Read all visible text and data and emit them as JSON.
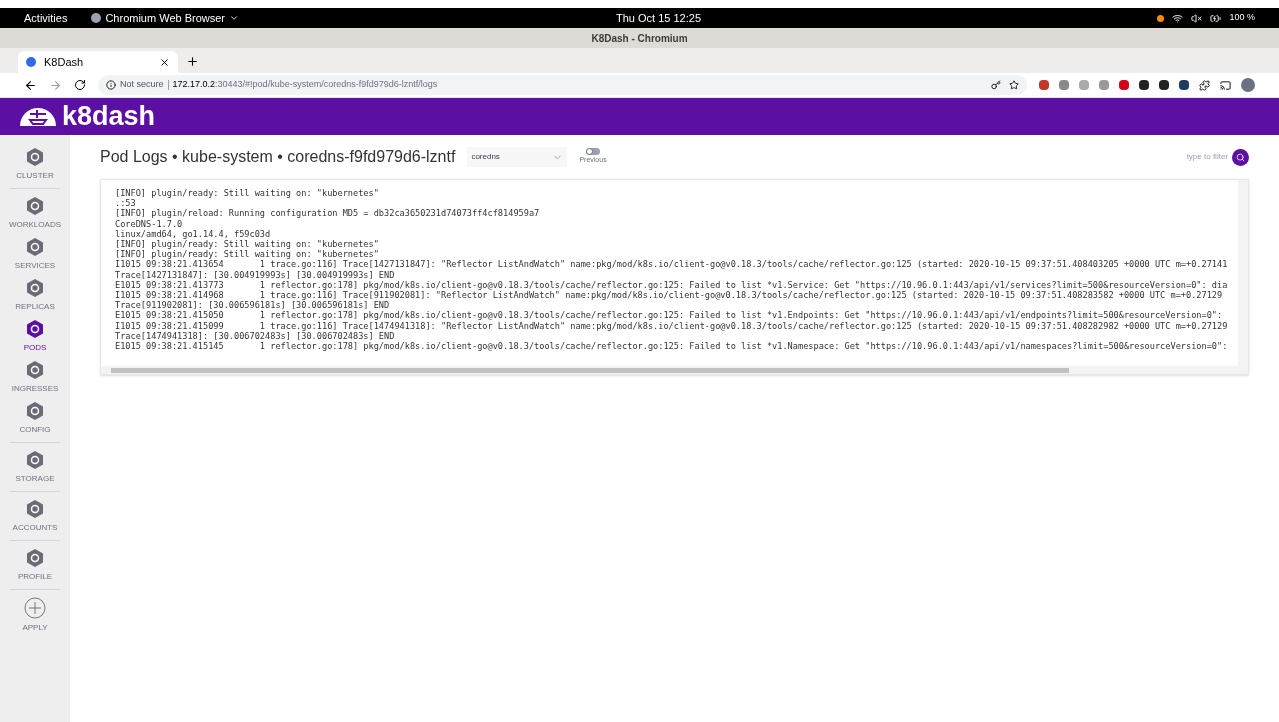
{
  "system_bar": {
    "activities": "Activities",
    "app_menu": "Chromium Web Browser",
    "clock": "Thu Oct 15  12:25",
    "battery": "100 %"
  },
  "window": {
    "title": "K8Dash - Chromium"
  },
  "tabs": [
    {
      "label": "K8Dash",
      "selected": true
    }
  ],
  "address_bar": {
    "security": "Not secure",
    "host": "172.17.0.2",
    "path": ":30443/#!pod/kube-system/coredns-f9fd979d6-lzntf/logs"
  },
  "app": {
    "logo": "k8dash"
  },
  "sidebar": {
    "items": [
      {
        "label": "CLUSTER",
        "selected": false,
        "divider_after": true
      },
      {
        "label": "WORKLOADS",
        "selected": false,
        "divider_after": false
      },
      {
        "label": "SERVICES",
        "selected": false,
        "divider_after": false
      },
      {
        "label": "REPLICAS",
        "selected": false,
        "divider_after": false
      },
      {
        "label": "PODS",
        "selected": true,
        "divider_after": false
      },
      {
        "label": "INGRESSES",
        "selected": false,
        "divider_after": false
      },
      {
        "label": "CONFIG",
        "selected": false,
        "divider_after": true
      },
      {
        "label": "STORAGE",
        "selected": false,
        "divider_after": true
      },
      {
        "label": "ACCOUNTS",
        "selected": false,
        "divider_after": true
      },
      {
        "label": "PROFILE",
        "selected": false,
        "divider_after": true
      },
      {
        "label": "APPLY",
        "selected": false,
        "divider_after": false
      }
    ]
  },
  "page": {
    "title": "Pod Logs • kube-system • coredns-f9fd979d6-lzntf",
    "container_select": "coredns",
    "previous_toggle": {
      "label": "Previous",
      "on": false
    },
    "filter": {
      "placeholder": "type to filter"
    }
  },
  "logs": [
    "[INFO] plugin/ready: Still waiting on: \"kubernetes\"",
    ".:53",
    "[INFO] plugin/reload: Running configuration MD5 = db32ca3650231d74073ff4cf814959a7",
    "CoreDNS-1.7.0",
    "linux/amd64, go1.14.4, f59c03d",
    "[INFO] plugin/ready: Still waiting on: \"kubernetes\"",
    "[INFO] plugin/ready: Still waiting on: \"kubernetes\"",
    "I1015 09:38:21.413654       1 trace.go:116] Trace[1427131847]: \"Reflector ListAndWatch\" name:pkg/mod/k8s.io/client-go@v0.18.3/tools/cache/reflector.go:125 (started: 2020-10-15 09:37:51.408403205 +0000 UTC m=+0.27141",
    "Trace[1427131847]: [30.004919993s] [30.004919993s] END",
    "E1015 09:38:21.413773       1 reflector.go:178] pkg/mod/k8s.io/client-go@v0.18.3/tools/cache/reflector.go:125: Failed to list *v1.Service: Get \"https://10.96.0.1:443/api/v1/services?limit=500&resourceVersion=0\": dia",
    "I1015 09:38:21.414968       1 trace.go:116] Trace[911902081]: \"Reflector ListAndWatch\" name:pkg/mod/k8s.io/client-go@v0.18.3/tools/cache/reflector.go:125 (started: 2020-10-15 09:37:51.408283582 +0000 UTC m=+0.27129",
    "Trace[911902081]: [30.006596181s] [30.006596181s] END",
    "E1015 09:38:21.415050       1 reflector.go:178] pkg/mod/k8s.io/client-go@v0.18.3/tools/cache/reflector.go:125: Failed to list *v1.Endpoints: Get \"https://10.96.0.1:443/api/v1/endpoints?limit=500&resourceVersion=0\":",
    "I1015 09:38:21.415099       1 trace.go:116] Trace[1474941318]: \"Reflector ListAndWatch\" name:pkg/mod/k8s.io/client-go@v0.18.3/tools/cache/reflector.go:125 (started: 2020-10-15 09:37:51.408282982 +0000 UTC m=+0.27129",
    "Trace[1474941318]: [30.006702483s] [30.006702483s] END",
    "E1015 09:38:21.415145       1 reflector.go:178] pkg/mod/k8s.io/client-go@v0.18.3/tools/cache/reflector.go:125: Failed to list *v1.Namespace: Get \"https://10.96.0.1:443/api/v1/namespaces?limit=500&resourceVersion=0\":"
  ]
}
